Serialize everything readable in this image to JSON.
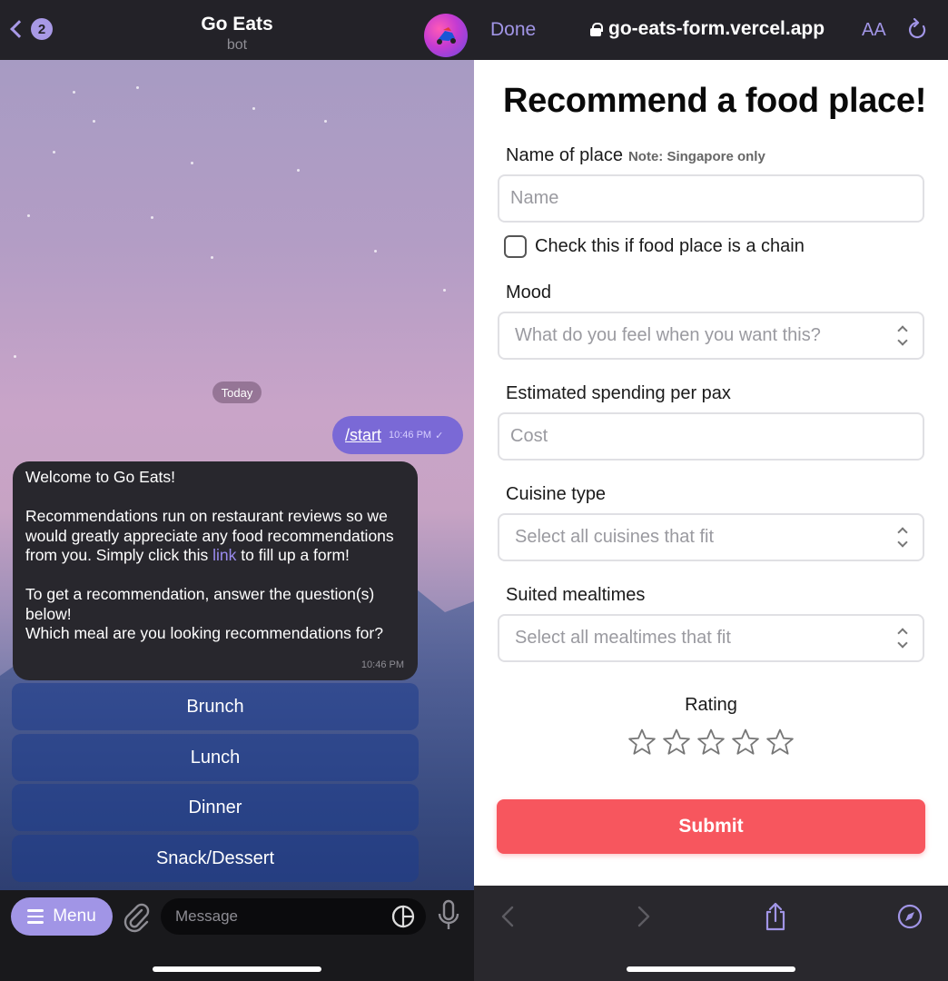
{
  "telegram": {
    "back_count": "2",
    "chat_title": "Go Eats",
    "chat_subtitle": "bot",
    "date_chip": "Today",
    "outgoing": {
      "text": "/start",
      "time": "10:46 PM"
    },
    "incoming": {
      "line1": "Welcome to Go Eats!",
      "para2_before": "Recommendations run on restaurant reviews so we would greatly appreciate any food recommendations from you. Simply click this ",
      "para2_link": "link",
      "para2_after": " to fill up a form!",
      "para3": "To get a recommendation, answer the question(s) below!\nWhich meal are you looking recommendations for?",
      "time": "10:46 PM"
    },
    "keyboard": [
      "Brunch",
      "Lunch",
      "Dinner",
      "Snack/Dessert"
    ],
    "menu_label": "Menu",
    "message_placeholder": "Message"
  },
  "safari": {
    "done_label": "Done",
    "url": "go-eats-form.vercel.app",
    "aa_label": "AA"
  },
  "form": {
    "title": "Recommend a food place!",
    "name_label": "Name of place",
    "name_note": "Note: Singapore only",
    "name_placeholder": "Name",
    "chain_label": "Check this if food place is a chain",
    "mood_label": "Mood",
    "mood_placeholder": "What do you feel when you want this?",
    "spend_label": "Estimated spending per pax",
    "spend_placeholder": "Cost",
    "cuisine_label": "Cuisine type",
    "cuisine_placeholder": "Select all cuisines that fit",
    "mealtime_label": "Suited mealtimes",
    "mealtime_placeholder": "Select all mealtimes that fit",
    "rating_label": "Rating",
    "rating_max": 5,
    "submit_label": "Submit"
  },
  "colors": {
    "telegram_accent": "#a195e6",
    "outgoing_bubble": "#7a69d6",
    "submit": "#f7565e"
  }
}
